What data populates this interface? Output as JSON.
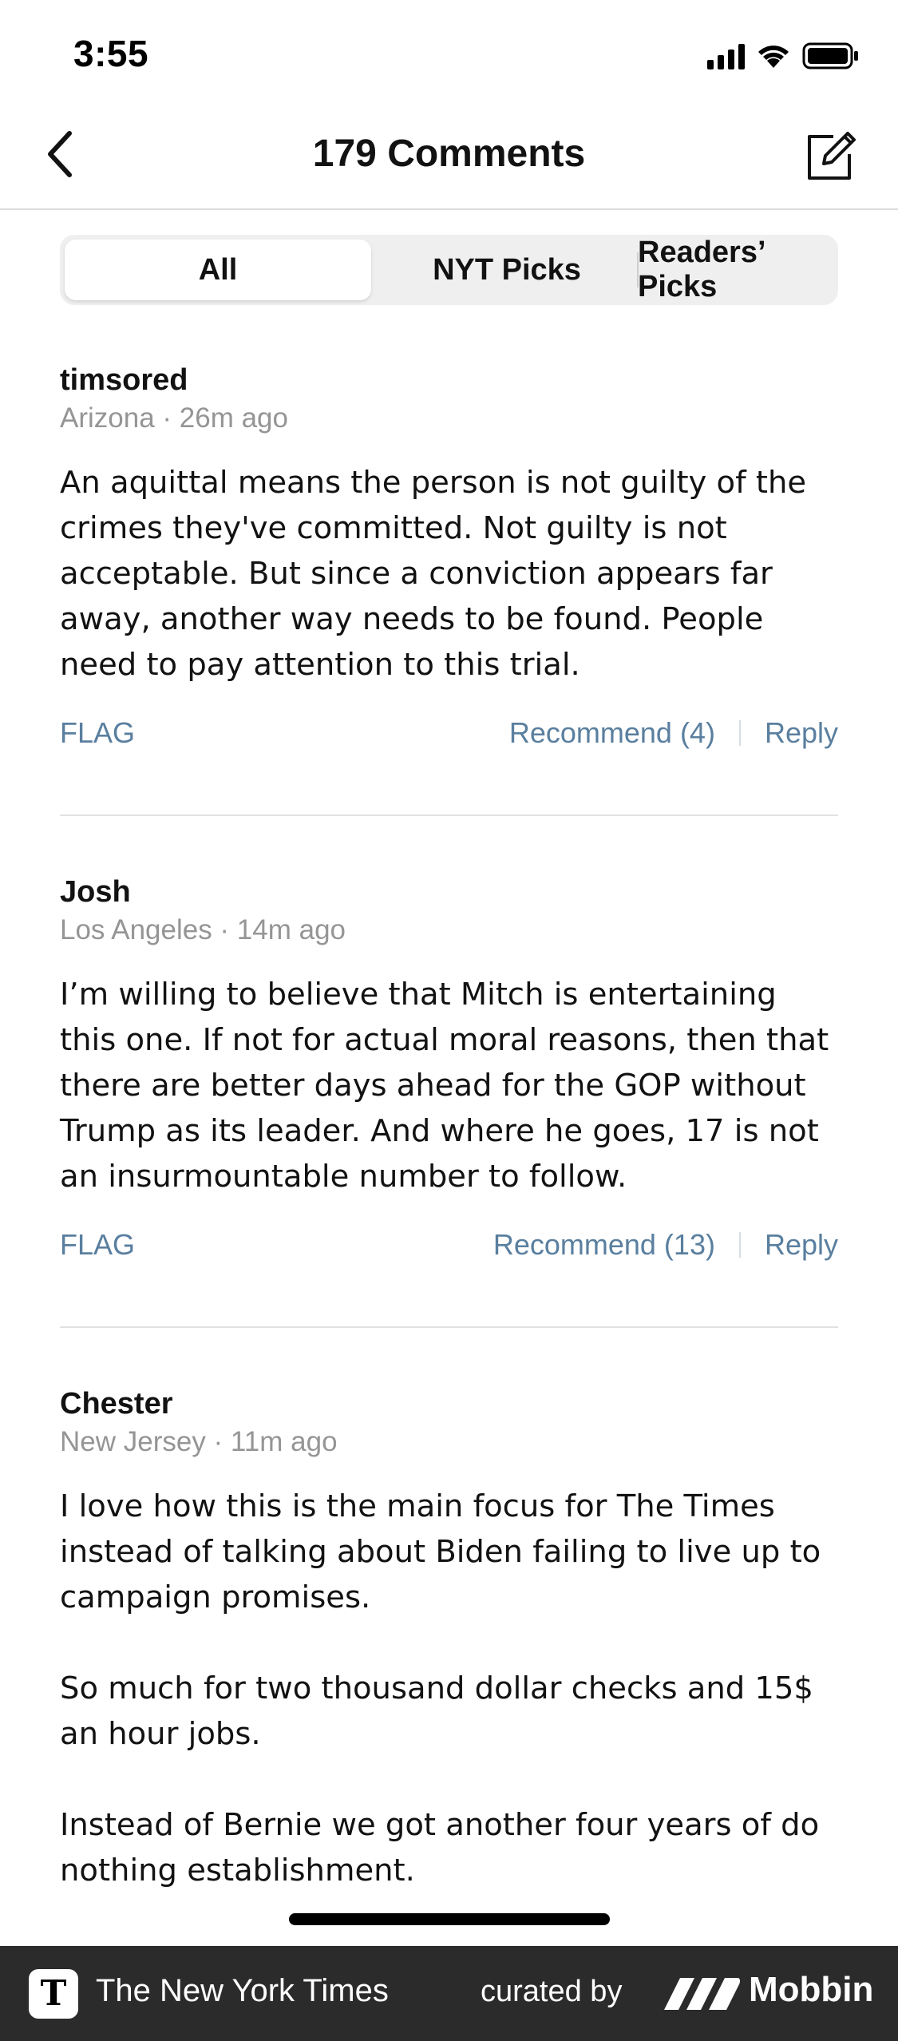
{
  "status_bar": {
    "time": "3:55"
  },
  "nav": {
    "title": "179 Comments"
  },
  "tabs": [
    {
      "label": "All",
      "selected": true
    },
    {
      "label": "NYT Picks",
      "selected": false
    },
    {
      "label": "Readers’ Picks",
      "selected": false
    }
  ],
  "comments": [
    {
      "author": "timsored",
      "location": "Arizona",
      "time": "26m ago",
      "meta": "Arizona · 26m ago",
      "paragraphs": [
        "An aquittal means the person is not guilty of the crimes they've committed. Not guilty is not acceptable. But since a conviction appears far away, another way needs to be found. People need to pay attention to this trial."
      ],
      "flag_label": "FLAG",
      "recommend_label": "Recommend (4)",
      "reply_label": "Reply"
    },
    {
      "author": "Josh",
      "location": "Los Angeles",
      "time": "14m ago",
      "meta": "Los Angeles · 14m ago",
      "paragraphs": [
        "I’m willing to believe that Mitch is entertaining this one. If not for actual moral reasons, then that there are better days ahead for the GOP without Trump as its leader. And where he goes, 17 is not an insurmountable number to follow."
      ],
      "flag_label": "FLAG",
      "recommend_label": "Recommend (13)",
      "reply_label": "Reply"
    },
    {
      "author": "Chester",
      "location": "New Jersey",
      "time": "11m ago",
      "meta": "New Jersey · 11m ago",
      "paragraphs": [
        "I love how this is the main focus for The Times instead of talking about Biden failing to live up to campaign promises.",
        "So much for two thousand dollar checks and 15$ an hour jobs.",
        "Instead of Bernie we got another four years of do nothing establishment."
      ]
    }
  ],
  "banner": {
    "publisher": "The New York Times",
    "curated_by": "curated by",
    "brand": "Mobbin"
  },
  "colors": {
    "action_link": "#5a7f9f",
    "meta_text": "#959595",
    "banner_bg": "#2b2b2b"
  },
  "icons": [
    "back-chevron-icon",
    "compose-icon",
    "signal-icon",
    "wifi-icon",
    "battery-icon",
    "nyt-logo-icon",
    "mobbin-logo-icon"
  ]
}
